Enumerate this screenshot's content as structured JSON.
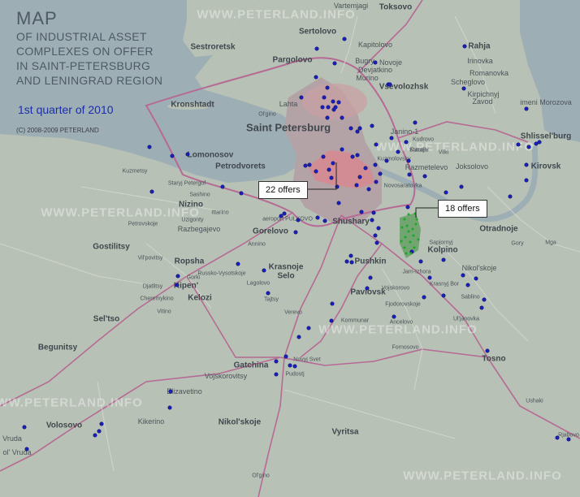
{
  "title": {
    "main": "MAP",
    "lines": [
      "OF INDUSTRIAL ASSET",
      "COMPLEXES ON OFFER",
      "IN SAINT-PETERSBURG",
      "AND LENINGRAD REGION"
    ],
    "quarter": "1st quarter of 2010",
    "copyright": "(C) 2008-2009 PETERLAND"
  },
  "watermark": "WWW.PETERLAND.INFO",
  "callouts": [
    {
      "label": "22 offers"
    },
    {
      "label": "18 offers"
    }
  ],
  "places": [
    {
      "name": "Vartemjagi",
      "size": "md"
    },
    {
      "name": "Toksovo",
      "size": "lg"
    },
    {
      "name": "Sertolovo",
      "size": "lg"
    },
    {
      "name": "Kapitolovo",
      "size": "md"
    },
    {
      "name": "Sestroretsk",
      "size": "lg"
    },
    {
      "name": "Pargolovo",
      "size": "lg"
    },
    {
      "name": "Bugry",
      "size": "md"
    },
    {
      "name": "Novoje",
      "size": "md"
    },
    {
      "name": "Devjatkino",
      "size": "md"
    },
    {
      "name": "Murino",
      "size": "md"
    },
    {
      "name": "Vsevolozhsk",
      "size": "lg"
    },
    {
      "name": "Rahja",
      "size": "lg"
    },
    {
      "name": "Irinovka",
      "size": "md"
    },
    {
      "name": "Romanovka",
      "size": "md"
    },
    {
      "name": "Scheglovo",
      "size": "md"
    },
    {
      "name": "Kirpichnyj",
      "size": "md"
    },
    {
      "name": "Zavod",
      "size": "md"
    },
    {
      "name": "imeni Morozova",
      "size": "md"
    },
    {
      "name": "Kronshtadt",
      "size": "lg"
    },
    {
      "name": "Lahta",
      "size": "md"
    },
    {
      "name": "Ol'gino",
      "size": "sm"
    },
    {
      "name": "Saint Petersburg",
      "size": "xl"
    },
    {
      "name": "Janino-1",
      "size": "md"
    },
    {
      "name": "Kudrovo",
      "size": "sm"
    },
    {
      "name": "Kutuzhi",
      "size": "sm"
    },
    {
      "name": "Staraja",
      "size": "sm"
    },
    {
      "name": "Vilki",
      "size": "sm"
    },
    {
      "name": "Shlissel'burg",
      "size": "lg"
    },
    {
      "name": "Lomonosov",
      "size": "lg"
    },
    {
      "name": "Petrodvorets",
      "size": "lg"
    },
    {
      "name": "Kuzmolovsky",
      "size": "sm"
    },
    {
      "name": "Razmetelevo",
      "size": "md"
    },
    {
      "name": "Joksolovo",
      "size": "md"
    },
    {
      "name": "Kirovsk",
      "size": "lg"
    },
    {
      "name": "Kuzmetsy",
      "size": "sm"
    },
    {
      "name": "Staryj Petergof",
      "size": "sm"
    },
    {
      "name": "Sashino",
      "size": "sm"
    },
    {
      "name": "Novosaratovka",
      "size": "sm"
    },
    {
      "name": "Nizino",
      "size": "lg"
    },
    {
      "name": "Ittarino",
      "size": "sm"
    },
    {
      "name": "Petrovskoje",
      "size": "sm"
    },
    {
      "name": "Uzigonty",
      "size": "sm"
    },
    {
      "name": "Razbegajevo",
      "size": "md"
    },
    {
      "name": "Gorelovo",
      "size": "lg"
    },
    {
      "name": "aeroport PULKOVO",
      "size": "sm"
    },
    {
      "name": "Shushary",
      "size": "lg"
    },
    {
      "name": "Otradnoje",
      "size": "lg"
    },
    {
      "name": "Sapjornyj",
      "size": "sm"
    },
    {
      "name": "Gory",
      "size": "sm"
    },
    {
      "name": "Mga",
      "size": "sm"
    },
    {
      "name": "Gostilitsy",
      "size": "lg"
    },
    {
      "name": "Annino",
      "size": "sm"
    },
    {
      "name": "Kolpino",
      "size": "lg"
    },
    {
      "name": "Vil'povitsy",
      "size": "sm"
    },
    {
      "name": "Ropsha",
      "size": "lg"
    },
    {
      "name": "Pushkin",
      "size": "lg"
    },
    {
      "name": "Jam-Izhora",
      "size": "sm"
    },
    {
      "name": "Nikol'skoje",
      "size": "md"
    },
    {
      "name": "Krasnoje",
      "size": "lg"
    },
    {
      "name": "Selo",
      "size": "lg"
    },
    {
      "name": "Russko-Vysotskoje",
      "size": "sm"
    },
    {
      "name": "Gorki",
      "size": "sm"
    },
    {
      "name": "Lagolovo",
      "size": "sm"
    },
    {
      "name": "Djatlitsy",
      "size": "sm"
    },
    {
      "name": "Kipen'",
      "size": "lg"
    },
    {
      "name": "Pavlovsk",
      "size": "lg"
    },
    {
      "name": "Vojskorovo",
      "size": "sm"
    },
    {
      "name": "Krasnyj Bor",
      "size": "sm"
    },
    {
      "name": "Cheremykino",
      "size": "sm"
    },
    {
      "name": "Kelozi",
      "size": "lg"
    },
    {
      "name": "Tajtsy",
      "size": "sm"
    },
    {
      "name": "Fjodorovskoje",
      "size": "sm"
    },
    {
      "name": "Sablino",
      "size": "sm"
    },
    {
      "name": "Vitino",
      "size": "sm"
    },
    {
      "name": "Verevo",
      "size": "sm"
    },
    {
      "name": "Sel'tso",
      "size": "lg"
    },
    {
      "name": "Kommunar",
      "size": "sm"
    },
    {
      "name": "Ancelovo",
      "size": "sm"
    },
    {
      "name": "Ul'janovka",
      "size": "sm"
    },
    {
      "name": "Begunitsy",
      "size": "lg"
    },
    {
      "name": "Fornosovo",
      "size": "sm"
    },
    {
      "name": "Novyj Svet",
      "size": "sm"
    },
    {
      "name": "Tosno",
      "size": "lg"
    },
    {
      "name": "Gatchina",
      "size": "lg"
    },
    {
      "name": "Vojskorovitsy",
      "size": "md"
    },
    {
      "name": "Pudostj",
      "size": "sm"
    },
    {
      "name": "Elizavetino",
      "size": "md"
    },
    {
      "name": "Ushaki",
      "size": "sm"
    },
    {
      "name": "Volosovo",
      "size": "lg"
    },
    {
      "name": "Kikerino",
      "size": "md"
    },
    {
      "name": "Nikol'skoje",
      "size": "lg"
    },
    {
      "name": "Vyritsa",
      "size": "lg"
    },
    {
      "name": "Rjabovo",
      "size": "sm"
    },
    {
      "name": "Vruda",
      "size": "md"
    },
    {
      "name": "ol' Vruda",
      "size": "md"
    },
    {
      "name": "Ol'gino",
      "size": "sm"
    }
  ]
}
